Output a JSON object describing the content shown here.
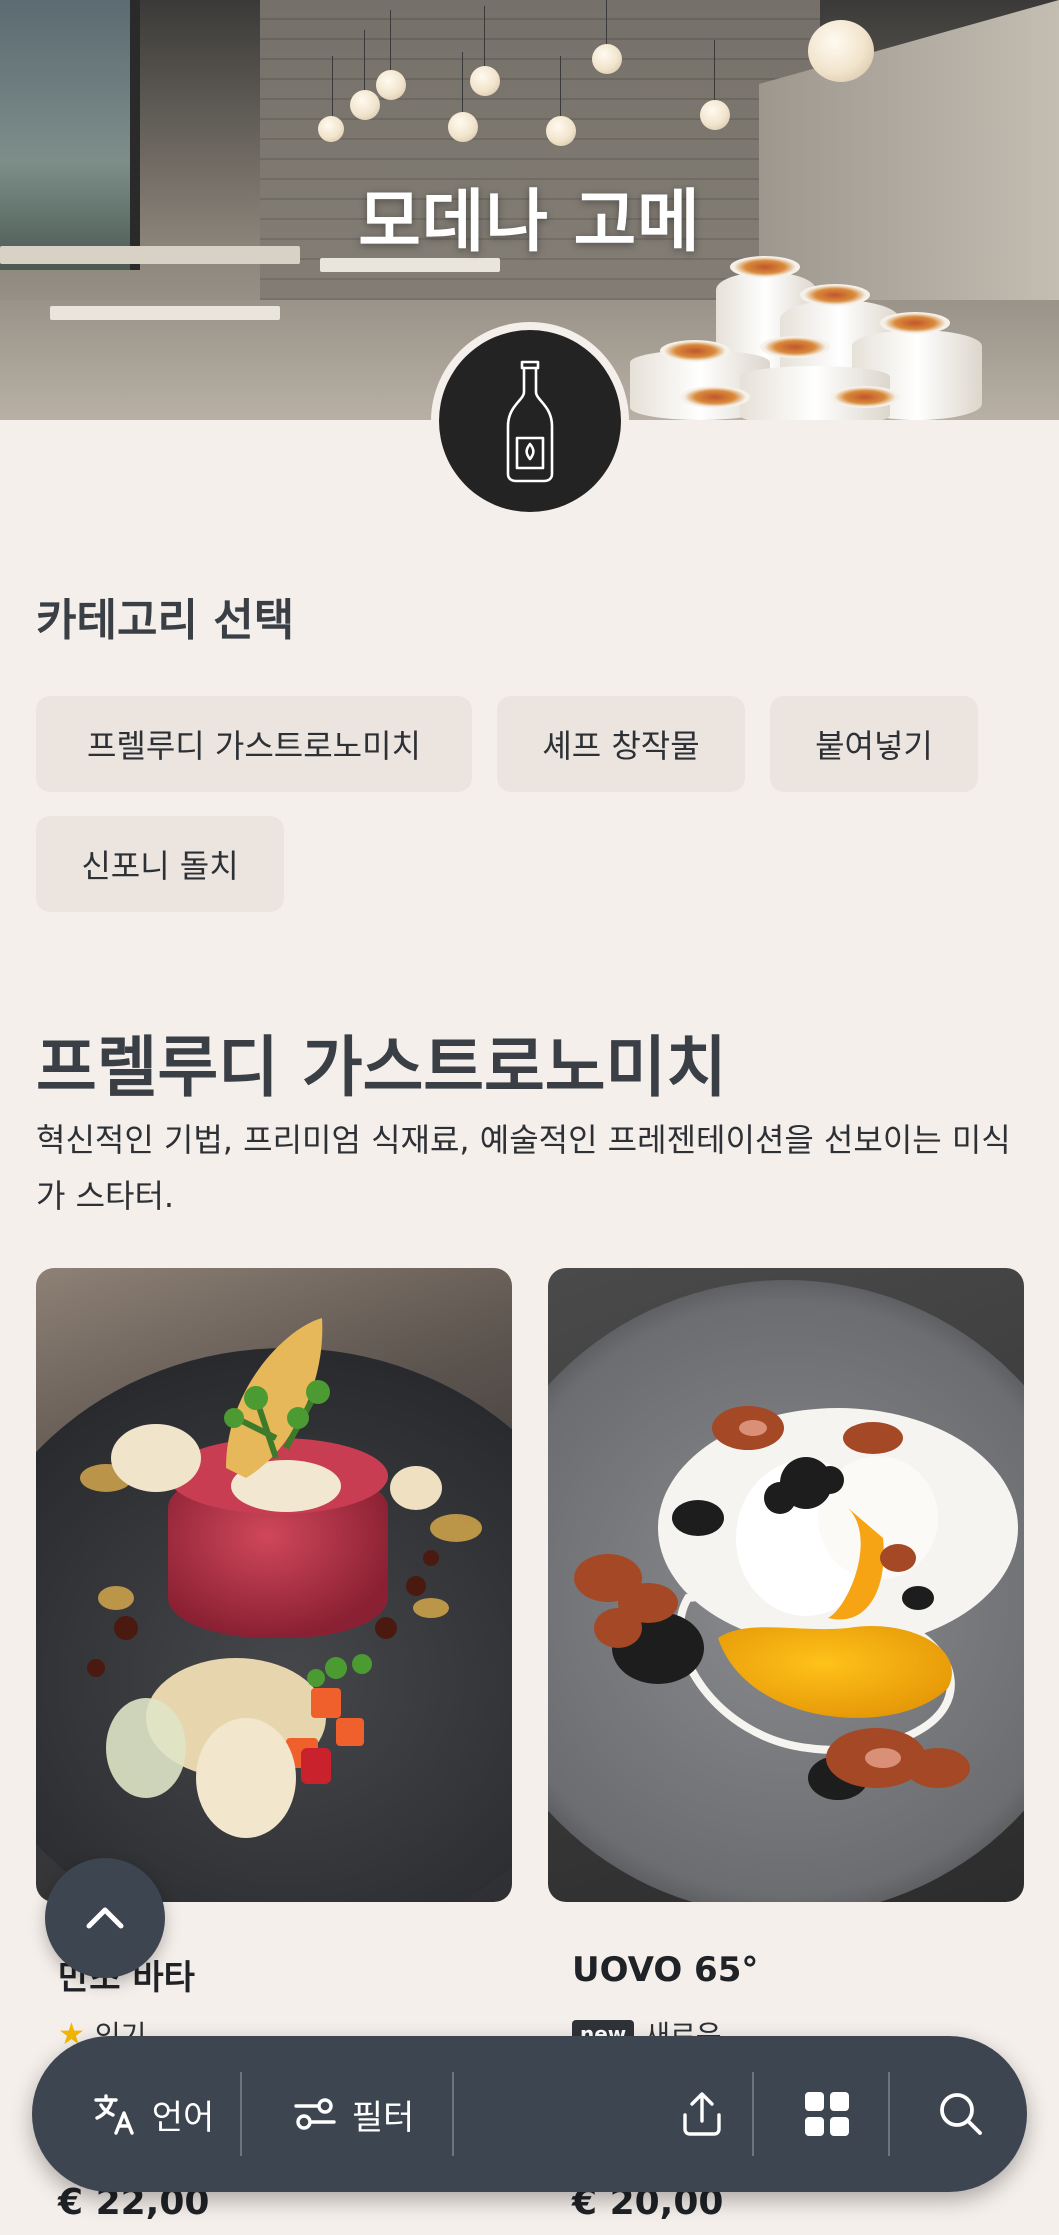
{
  "hero": {
    "title": "모데나 고메"
  },
  "logo": {
    "icon": "bottle-icon"
  },
  "categories": {
    "label": "카테고리 선택",
    "items": [
      {
        "label": "프렐루디 가스트로노미치"
      },
      {
        "label": "셰프 창작물"
      },
      {
        "label": "붙여넣기"
      },
      {
        "label": "신포니 돌치"
      }
    ]
  },
  "section": {
    "title": "프렐루디 가스트로노미치",
    "description": "혁신적인 기법, 프리미엄 식재료, 예술적인 프레젠테이션을 선보이는 미식가 스타터."
  },
  "dishes": [
    {
      "name": "만조 바타",
      "tag": "인기",
      "tag_icon": "star-icon",
      "price": "€ 22,00"
    },
    {
      "name": "UOVO 65°",
      "badge": "new",
      "tag": "새로운",
      "price": "€ 20,00"
    }
  ],
  "bottom_bar": {
    "language_label": "언어",
    "filter_label": "필터",
    "icons": [
      "translate-icon",
      "filter-icon",
      "share-icon",
      "grid-icon",
      "search-icon"
    ]
  },
  "colors": {
    "background": "#f5efeb",
    "chip": "#ebe4df",
    "bar": "#3d4550",
    "star": "#f2b705"
  }
}
